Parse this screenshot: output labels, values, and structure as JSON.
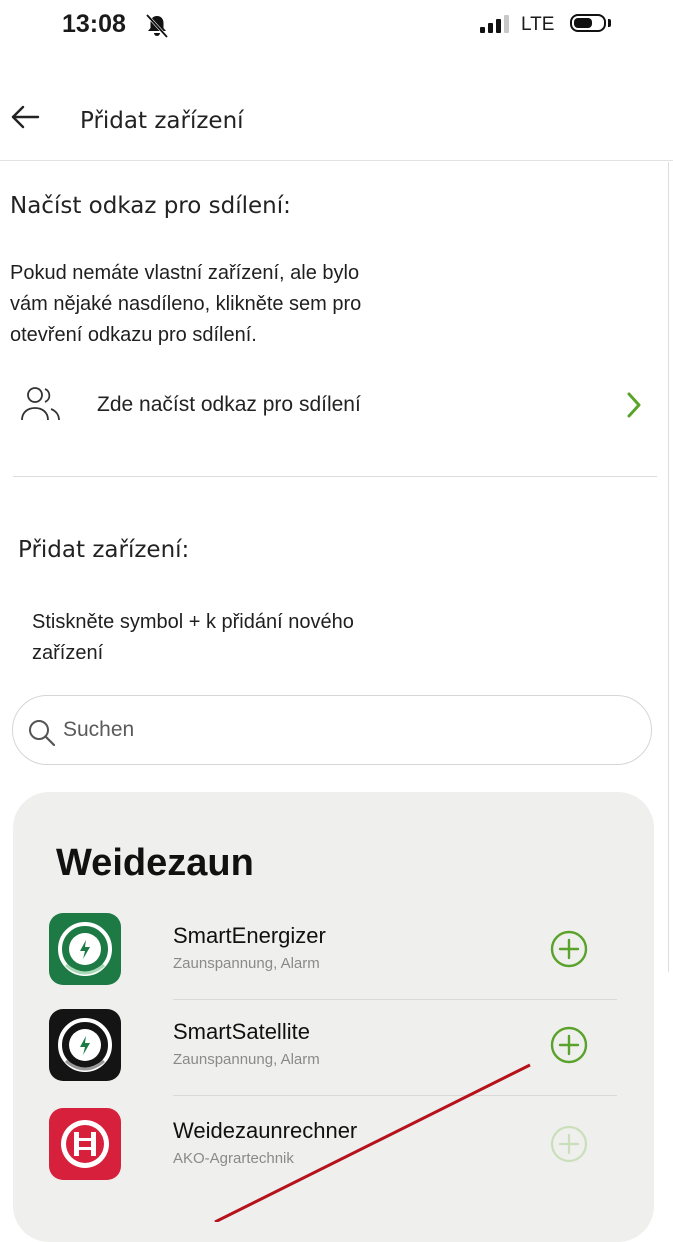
{
  "status_bar": {
    "time": "13:08",
    "network": "LTE",
    "icons": [
      "bell-slash-icon",
      "signal-icon",
      "battery-icon"
    ]
  },
  "nav": {
    "back_icon": "arrow-left-icon",
    "title": "Přidat zařízení"
  },
  "share_section": {
    "title": "Načíst odkaz pro sdílení:",
    "description_lines": [
      "Pokud nemáte vlastní zařízení, ale bylo",
      "vám nějaké nasdíleno, klikněte sem pro",
      "otevření odkazu pro sdílení."
    ],
    "link_label": "Zde načíst odkaz pro sdílení",
    "link_icon": "users-icon",
    "chevron_icon": "chevron-right-icon"
  },
  "add_section": {
    "title": "Přidat zařízení:",
    "instruction_lines": [
      "Stiskněte symbol + k přidání nového",
      "zařízení"
    ]
  },
  "search": {
    "placeholder": "Suchen",
    "value": ""
  },
  "category": {
    "title": "Weidezaun",
    "devices": [
      {
        "name": "SmartEnergizer",
        "subtitle": "Zaunspannung, Alarm",
        "icon": "smart-energizer-app-icon",
        "add_enabled": true
      },
      {
        "name": "SmartSatellite",
        "subtitle": "Zaunspannung, Alarm",
        "icon": "smart-satellite-app-icon",
        "add_enabled": true
      },
      {
        "name": "Weidezaunrechner",
        "subtitle": "AKO-Agrartechnik",
        "icon": "weidezaunrechner-app-icon",
        "add_enabled": false
      }
    ]
  },
  "colors": {
    "accent_green": "#5aa32a",
    "disabled_green": "#c9dfba",
    "card_bg": "#efefed",
    "energizer_green": "#1e7a45",
    "satellite_black": "#141414",
    "rechner_red": "#d7203c",
    "annotation_red": "#b5121b"
  }
}
